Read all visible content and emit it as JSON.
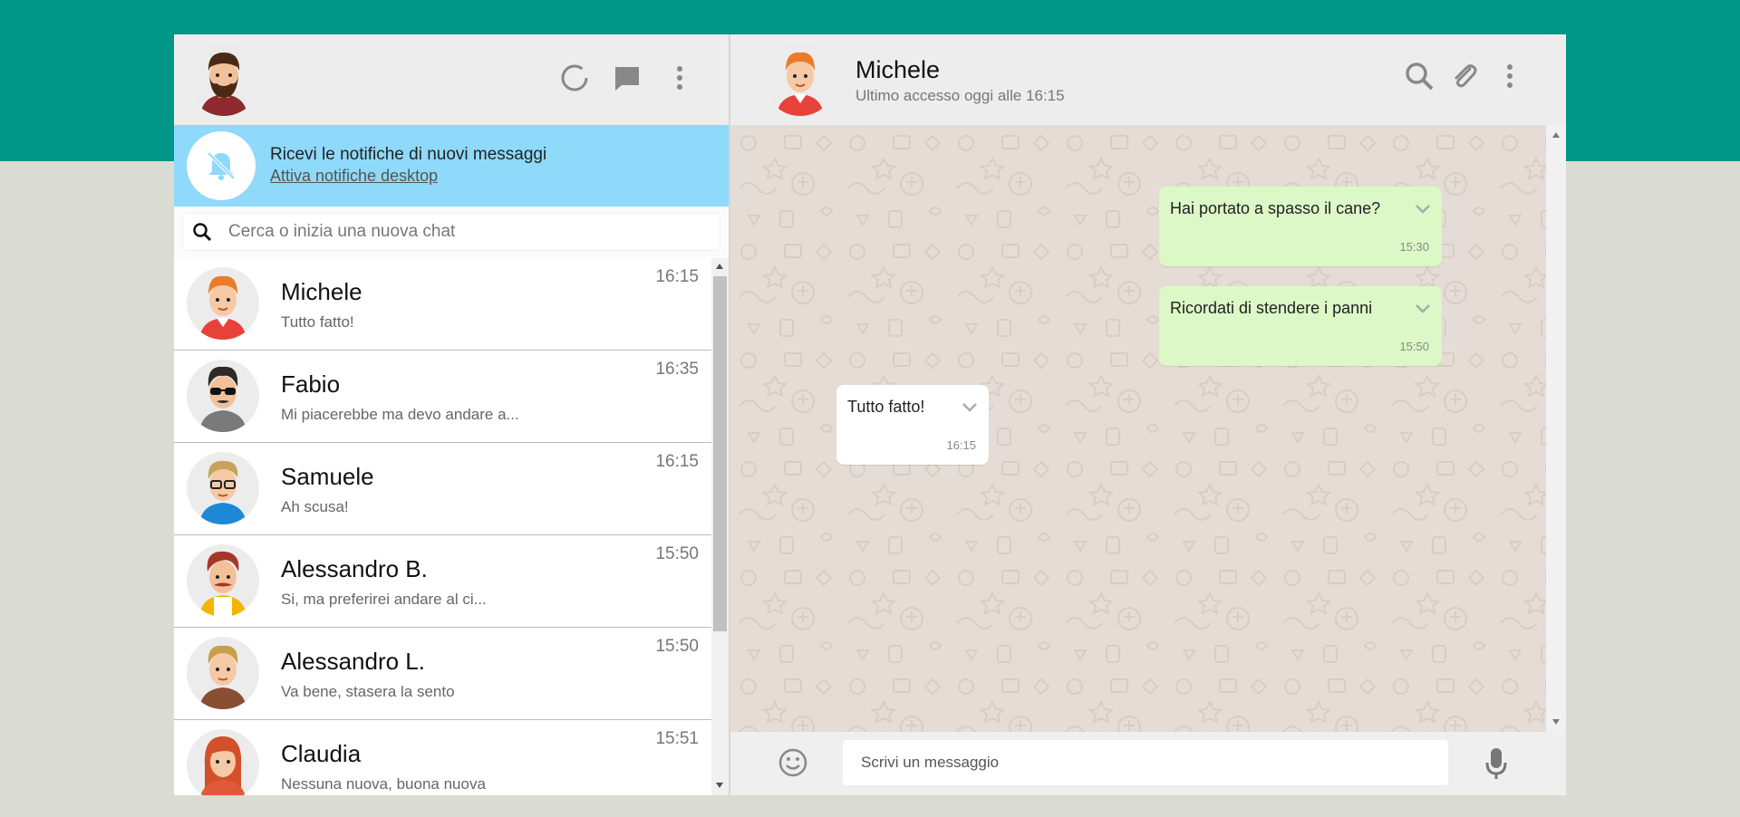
{
  "colors": {
    "accent": "#009688",
    "page_bg": "#dadbd3",
    "panel_header": "#ededed",
    "notification_bg": "#8fd9fa",
    "sent_bubble": "#dcf8c6",
    "received_bubble": "#ffffff",
    "conversation_bg": "#e5ddd5"
  },
  "left_header": {
    "icons": [
      "status-icon",
      "new-chat-icon",
      "menu-icon"
    ]
  },
  "notification": {
    "title": "Ricevi le notifiche di nuovi messaggi",
    "link": "Attiva notifiche desktop",
    "icon": "bell-off-icon"
  },
  "search": {
    "placeholder": "Cerca o inizia una nuova chat",
    "value": ""
  },
  "chats": [
    {
      "name": "Michele",
      "last_message": "Tutto fatto!",
      "time": "16:15"
    },
    {
      "name": "Fabio",
      "last_message": "Mi piacerebbe ma devo andare a...",
      "time": "16:35"
    },
    {
      "name": "Samuele",
      "last_message": "Ah scusa!",
      "time": "16:15"
    },
    {
      "name": "Alessandro B.",
      "last_message": "Si, ma preferirei andare al ci...",
      "time": "15:50"
    },
    {
      "name": "Alessandro L.",
      "last_message": "Va bene, stasera la sento",
      "time": "15:50"
    },
    {
      "name": "Claudia",
      "last_message": "Nessuna nuova, buona nuova",
      "time": "15:51"
    }
  ],
  "active_chat": {
    "name": "Michele",
    "status": "Ultimo accesso oggi alle 16:15",
    "icons": [
      "search-icon",
      "attach-icon",
      "menu-icon"
    ]
  },
  "messages": [
    {
      "direction": "sent",
      "text": "Hai portato a spasso il cane?",
      "time": "15:30"
    },
    {
      "direction": "sent",
      "text": "Ricordati di stendere i panni",
      "time": "15:50"
    },
    {
      "direction": "received",
      "text": "Tutto fatto!",
      "time": "16:15"
    }
  ],
  "composer": {
    "placeholder": "Scrivi un messaggio",
    "value": "",
    "icons": [
      "emoji-icon",
      "microphone-icon"
    ]
  }
}
